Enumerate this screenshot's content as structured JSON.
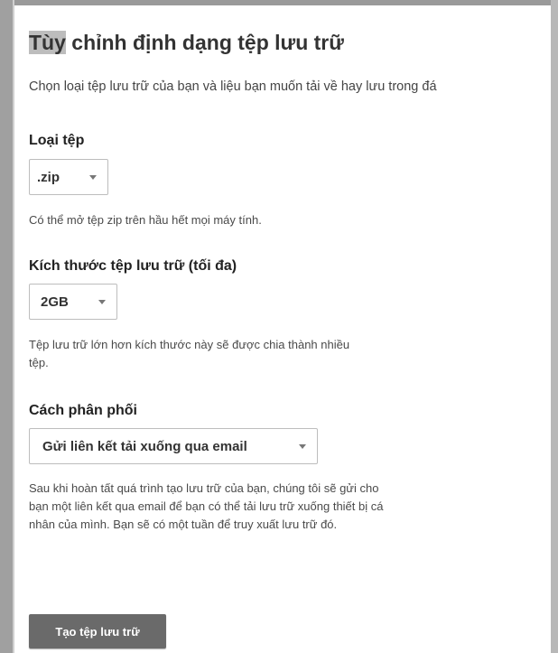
{
  "page": {
    "title_highlight": "Tùy",
    "title_rest": " chỉnh định dạng tệp lưu trữ",
    "intro": "Chọn loại tệp lưu trữ của bạn và liệu bạn muốn tải về hay lưu trong đá"
  },
  "file_type": {
    "label": "Loại tệp",
    "value": ".zip",
    "help": "Có thể mở tệp zip trên hầu hết mọi máy tính."
  },
  "archive_size": {
    "label": "Kích thước tệp lưu trữ (tối đa)",
    "value": "2GB",
    "help": "Tệp lưu trữ lớn hơn kích thước này sẽ được chia thành nhiều tệp."
  },
  "delivery": {
    "label": "Cách phân phối",
    "value": "Gửi liên kết tải xuống qua email",
    "help": "Sau khi hoàn tất quá trình tạo lưu trữ của bạn, chúng tôi sẽ gửi cho bạn một liên kết qua email để bạn có thể tải lưu trữ xuống thiết bị cá nhân của mình. Bạn sẽ có một tuần để truy xuất lưu trữ đó."
  },
  "actions": {
    "create_label": "Tạo tệp lưu trữ"
  },
  "icons": {
    "dropdown": "caret-down-icon"
  },
  "colors": {
    "button_bg": "#6a6a6a",
    "title_highlight": "#bdbdbd"
  }
}
